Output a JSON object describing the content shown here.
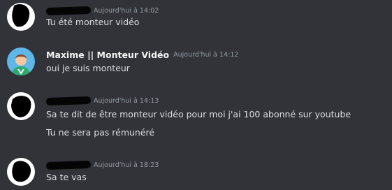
{
  "messages": [
    {
      "author": "",
      "timestamp": "Aujourd'hui à 14:02",
      "lines": [
        "Tu été monteur vidéo"
      ]
    },
    {
      "author": "Maxime || Monteur Vidéo",
      "timestamp": "Aujourd'hui à 14:12",
      "lines": [
        "oui je suis monteur"
      ]
    },
    {
      "author": "",
      "timestamp": "Aujourd'hui à 14:13",
      "lines": [
        "Sa te dit de être monteur vidéo pour moi j'ai 100 abonné sur youtube",
        "Tu ne sera pas rémunéré"
      ]
    },
    {
      "author": "",
      "timestamp": "Aujourd'hui à 18:23",
      "lines": [
        "Sa te vas"
      ]
    }
  ],
  "colors": {
    "background": "#313338",
    "username": "#f2f3f5",
    "timestamp": "#949ba4",
    "message_text": "#dbdee1",
    "avatar_maxime_bg": "#5fb6e8",
    "avatar_maxime_shirt": "#2faa6e"
  }
}
